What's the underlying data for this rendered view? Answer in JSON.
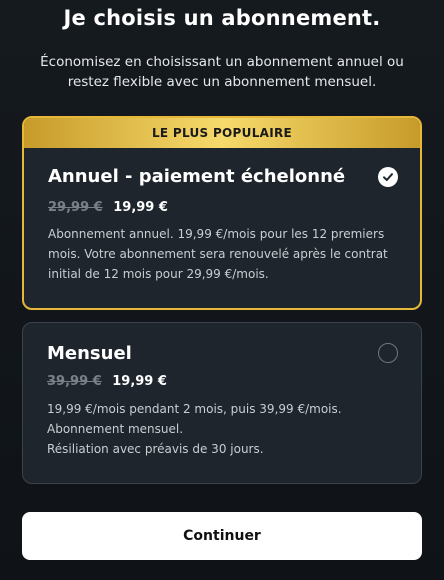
{
  "header": {
    "title": "Je choisis un abonnement.",
    "subtitle": "Économisez en choisissant un abonnement annuel ou restez flexible avec un abonnement mensuel."
  },
  "plans": {
    "annual": {
      "badge": "LE PLUS POPULAIRE",
      "name": "Annuel - paiement échelonné",
      "old_price": "29,99 €",
      "new_price": "19,99 €",
      "description": "Abonnement annuel. 19,99 €/mois pour les 12 premiers mois. Votre abonnement sera renouvelé après le contrat initial de 12 mois pour 29,99 €/mois.",
      "selected": true
    },
    "monthly": {
      "name": "Mensuel",
      "old_price": "39,99 €",
      "new_price": "19,99 €",
      "description_lines": [
        "19,99 €/mois pendant 2 mois, puis 39,99 €/mois.",
        "Abonnement mensuel.",
        "Résiliation avec préavis de 30 jours."
      ],
      "selected": false
    }
  },
  "actions": {
    "continue_label": "Continuer"
  },
  "colors": {
    "background": "#12161b",
    "card": "#1e252c",
    "accent_gold": "#e6b739",
    "button": "#ffffff"
  },
  "icons": {
    "selected": "check-icon",
    "unselected": "radio-empty-icon"
  }
}
